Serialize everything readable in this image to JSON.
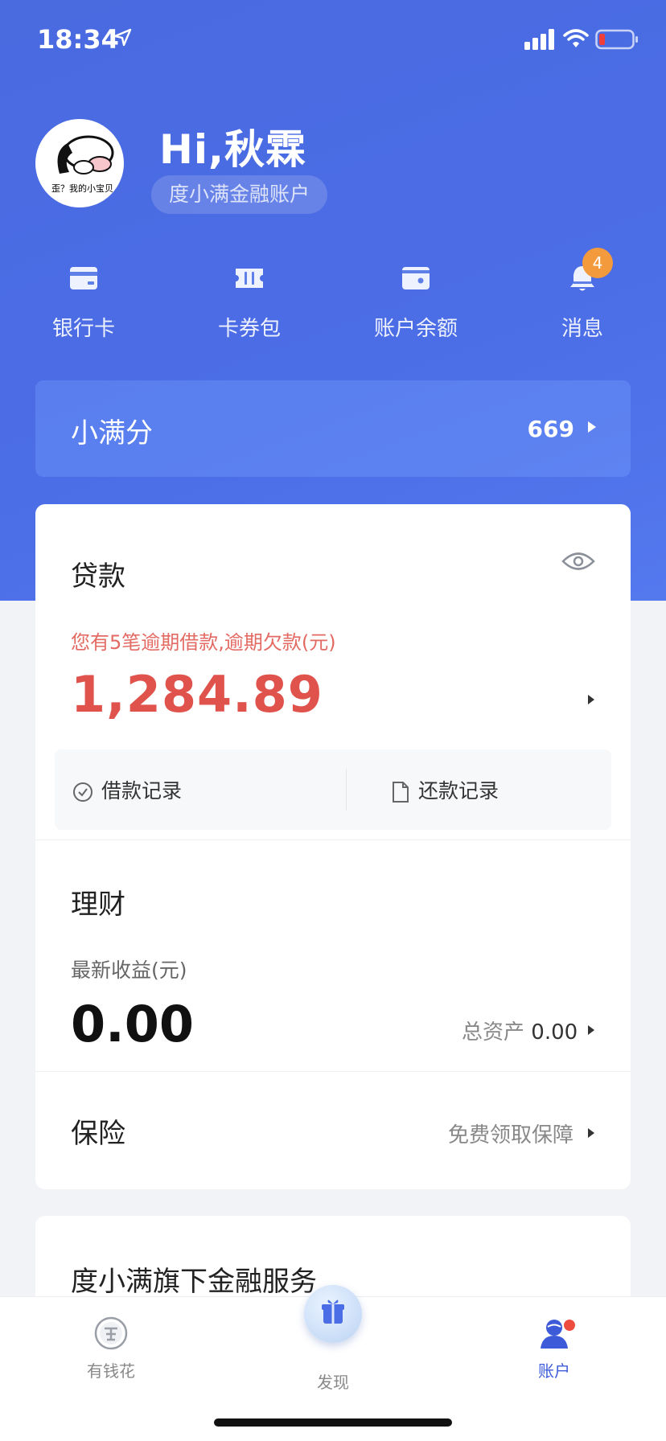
{
  "status_bar": {
    "time": "18:34"
  },
  "profile": {
    "greeting": "Hi,秋霖",
    "account_label": "度小满金融账户",
    "avatar_caption": "歪？我的小宝贝"
  },
  "quick_actions": [
    {
      "label": "银行卡",
      "icon": "bank-card-icon"
    },
    {
      "label": "卡券包",
      "icon": "coupon-icon"
    },
    {
      "label": "账户余额",
      "icon": "wallet-icon"
    },
    {
      "label": "消息",
      "icon": "bell-icon",
      "badge": "4"
    }
  ],
  "score": {
    "label": "小满分",
    "value": "669"
  },
  "loan": {
    "title": "贷款",
    "overdue_notice": "您有5笔逾期借款,逾期欠款(元)",
    "overdue_amount": "1,284.89",
    "borrow_records": "借款记录",
    "repay_records": "还款记录"
  },
  "wealth": {
    "title": "理财",
    "latest_income_label": "最新收益(元)",
    "latest_income": "0.00",
    "total_assets_label": "总资产",
    "total_assets": "0.00"
  },
  "insurance": {
    "title": "保险",
    "action": "免费领取保障"
  },
  "services": {
    "title": "度小满旗下金融服务"
  },
  "tabbar": {
    "tabs": [
      {
        "label": "有钱花",
        "active": false
      },
      {
        "label": "发现",
        "active": false
      },
      {
        "label": "账户",
        "active": true
      }
    ]
  },
  "colors": {
    "accent": "#4b6de6",
    "overdue": "#e0524c",
    "badge": "#f39a3c"
  }
}
